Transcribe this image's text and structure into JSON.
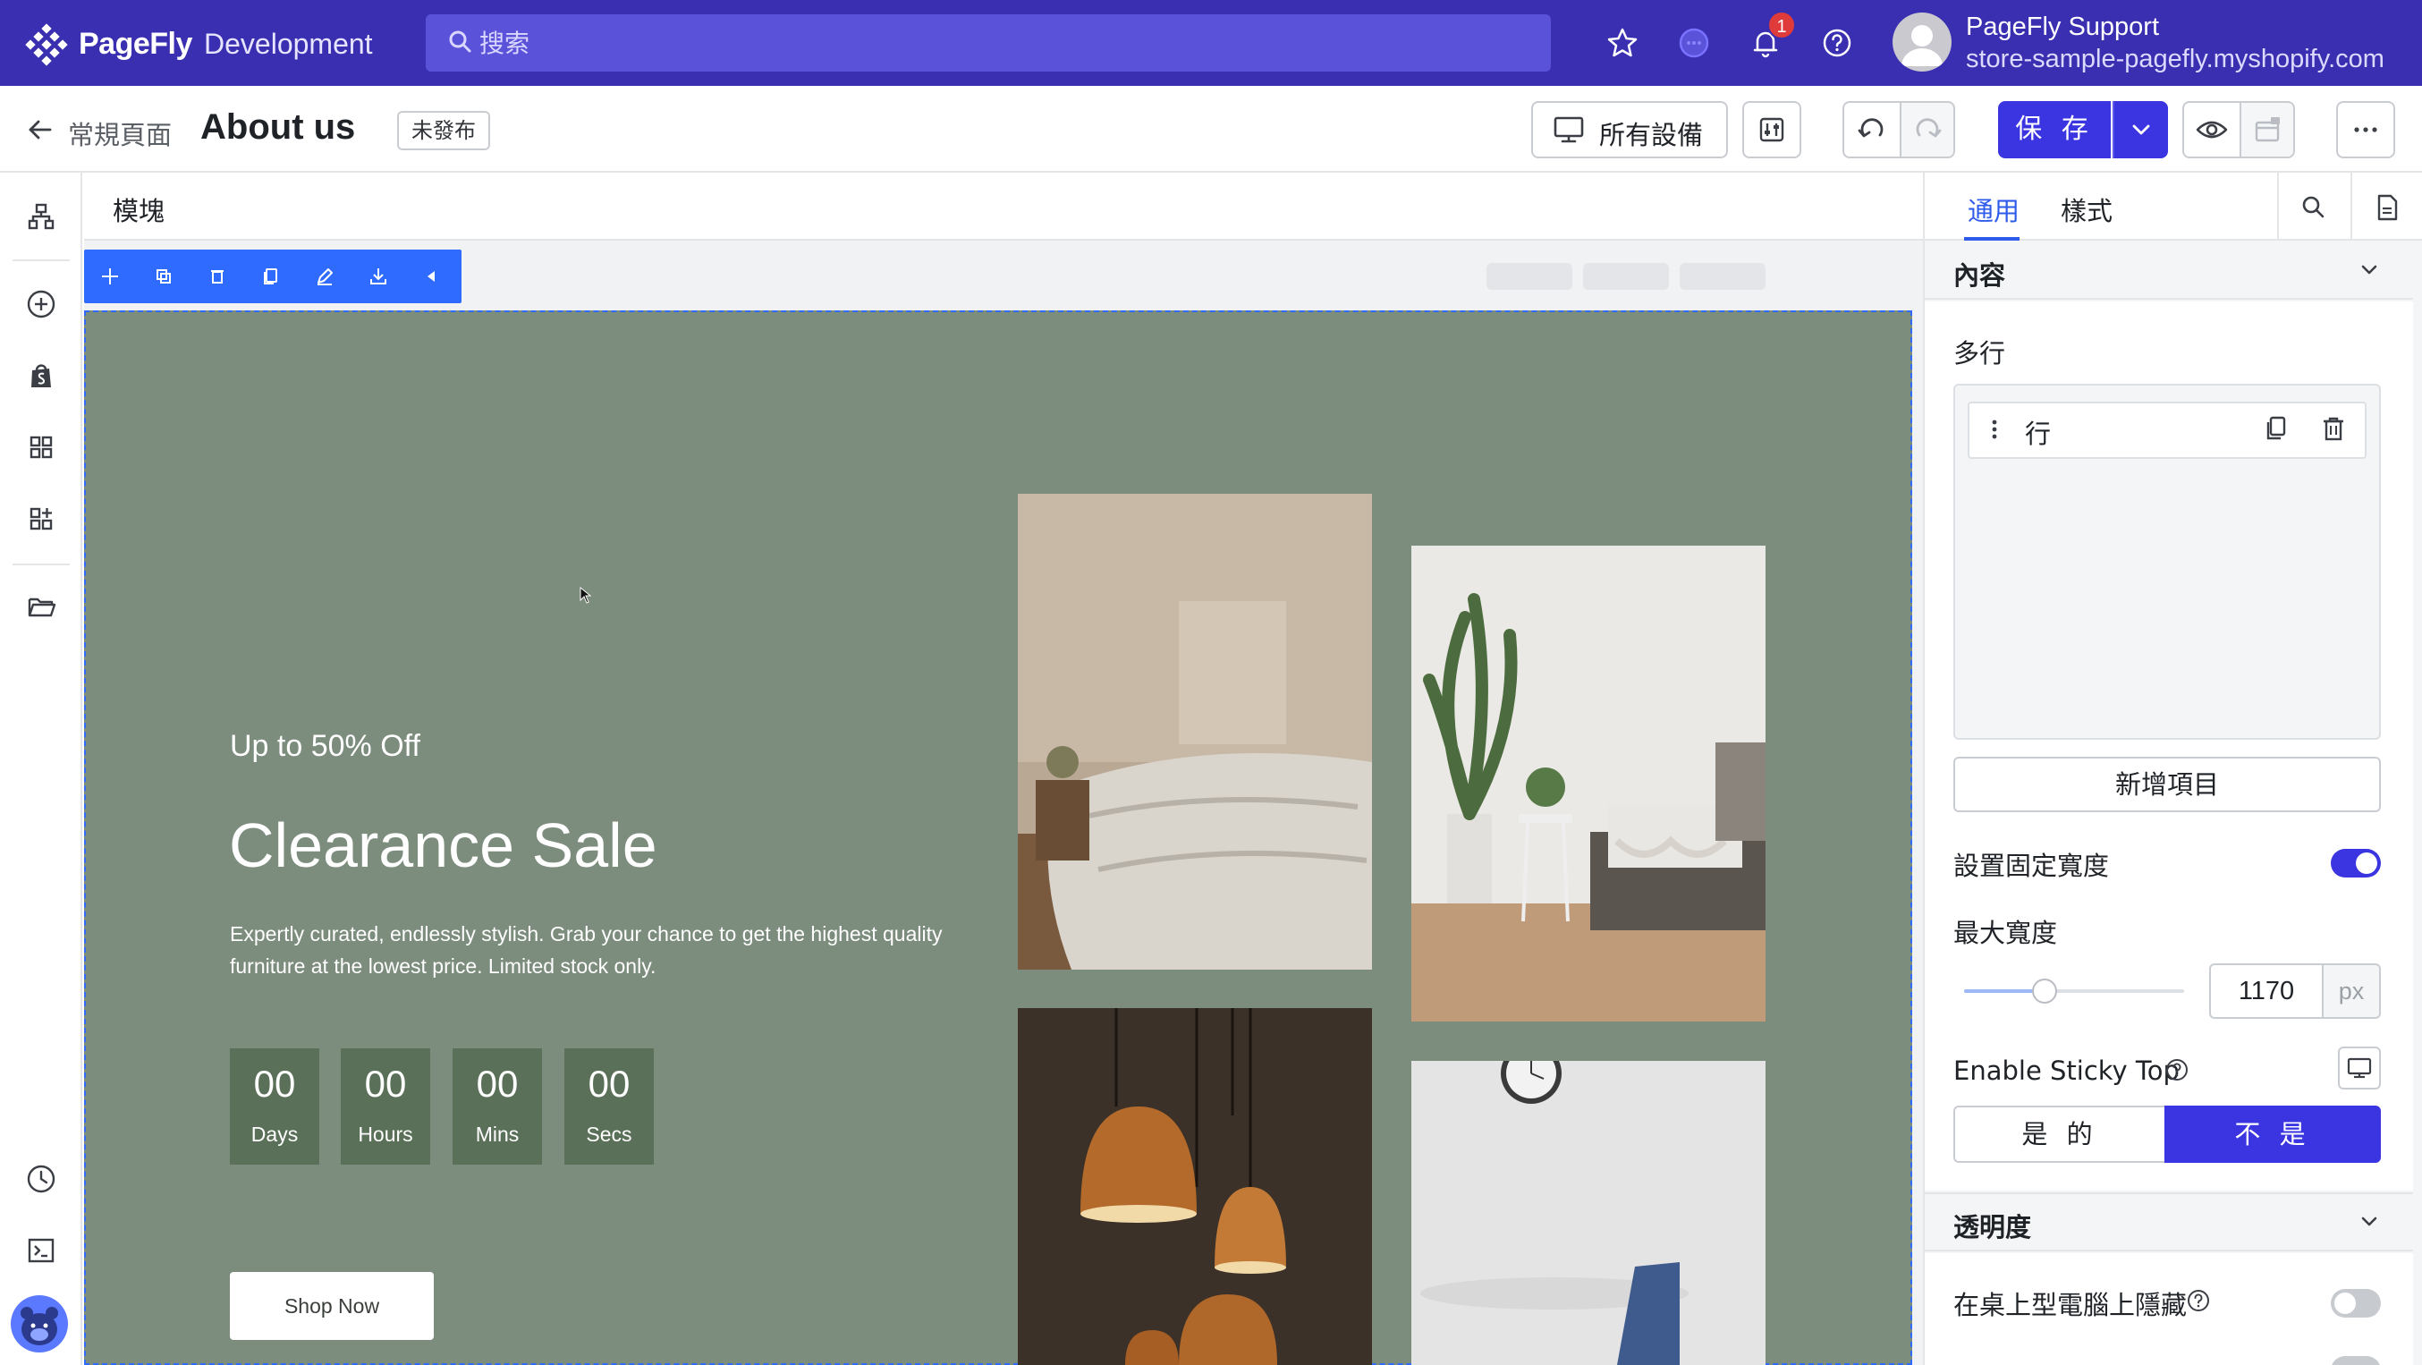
{
  "topbar": {
    "brand": "PageFly",
    "environment": "Development",
    "search_placeholder": "搜索",
    "notification_count": "1",
    "account_name": "PageFly Support",
    "account_store": "store-sample-pagefly.myshopify.com"
  },
  "pagebar": {
    "breadcrumb": "常規頁面",
    "title": "About us",
    "status": "未發布",
    "device_label": "所有設備",
    "save_label": "保 存"
  },
  "canvas": {
    "section_label": "模塊",
    "hero": {
      "eyebrow": "Up to 50% Off",
      "title": "Clearance Sale",
      "description": "Expertly curated, endlessly stylish. Grab your chance to get the highest quality furniture at the lowest price. Limited stock only.",
      "countdown": [
        {
          "value": "00",
          "unit": "Days"
        },
        {
          "value": "00",
          "unit": "Hours"
        },
        {
          "value": "00",
          "unit": "Mins"
        },
        {
          "value": "00",
          "unit": "Secs"
        }
      ],
      "cta": "Shop Now"
    }
  },
  "panel": {
    "tabs": [
      "通用",
      "樣式"
    ],
    "content_section": "內容",
    "rows_label": "多行",
    "row_item": "行",
    "add_item": "新增項目",
    "fixed_width_label": "設置固定寬度",
    "fixed_width_enabled": true,
    "max_width_label": "最大寬度",
    "max_width_value": "1170",
    "max_width_unit": "px",
    "sticky_label": "Enable Sticky Top",
    "sticky_yes": "是 的",
    "sticky_no": "不 是",
    "sticky_selected": "不 是",
    "opacity_section": "透明度",
    "hide_desktop_label": "在桌上型電腦上隱藏",
    "hide_desktop_enabled": false
  },
  "colors": {
    "topbar": "#3a2fb0",
    "primary": "#3a35e0",
    "hero_bg": "#7c8c7d",
    "countdown_bg": "#5a7058",
    "selection": "#2f6bff"
  },
  "icons": {
    "topbar": [
      "search-icon",
      "star-icon",
      "chat-icon",
      "bell-icon",
      "help-icon"
    ],
    "left_rail": [
      "sitemap-icon",
      "add-element-icon",
      "shopify-icon",
      "grid-icon",
      "grid-add-icon",
      "folder-icon",
      "history-icon",
      "terminal-icon"
    ]
  }
}
